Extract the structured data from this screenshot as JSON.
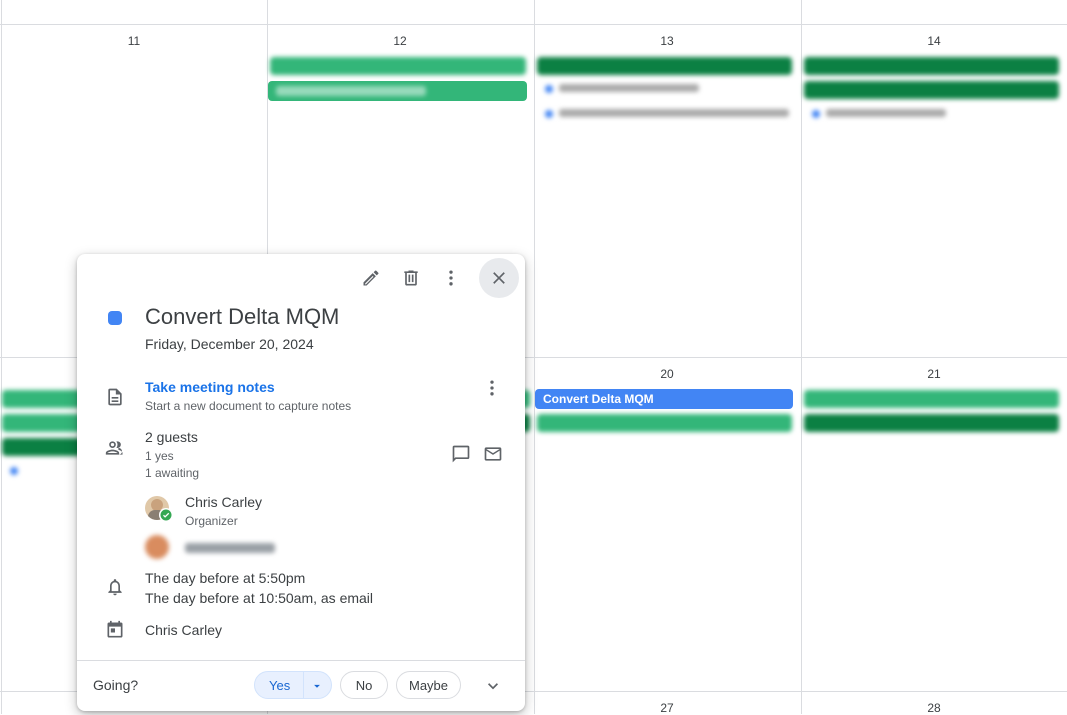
{
  "calendar": {
    "days_row1": [
      "11",
      "12",
      "13",
      "14"
    ],
    "days_row2": [
      "20",
      "21"
    ],
    "days_row3": [
      "27",
      "28"
    ],
    "highlight_event": "Convert Delta MQM"
  },
  "popup": {
    "title": "Convert Delta MQM",
    "date": "Friday, December 20, 2024",
    "color": "#4285f4",
    "notes": {
      "title": "Take meeting notes",
      "subtitle": "Start a new document to capture notes"
    },
    "guests": {
      "count": "2 guests",
      "yes": "1 yes",
      "awaiting": "1 awaiting"
    },
    "people": [
      {
        "name": "Chris Carley",
        "role": "Organizer"
      }
    ],
    "reminders": [
      "The day before at 5:50pm",
      "The day before at 10:50am, as email"
    ],
    "calendar_owner": "Chris Carley",
    "rsvp": {
      "label": "Going?",
      "yes": "Yes",
      "no": "No",
      "maybe": "Maybe"
    }
  }
}
